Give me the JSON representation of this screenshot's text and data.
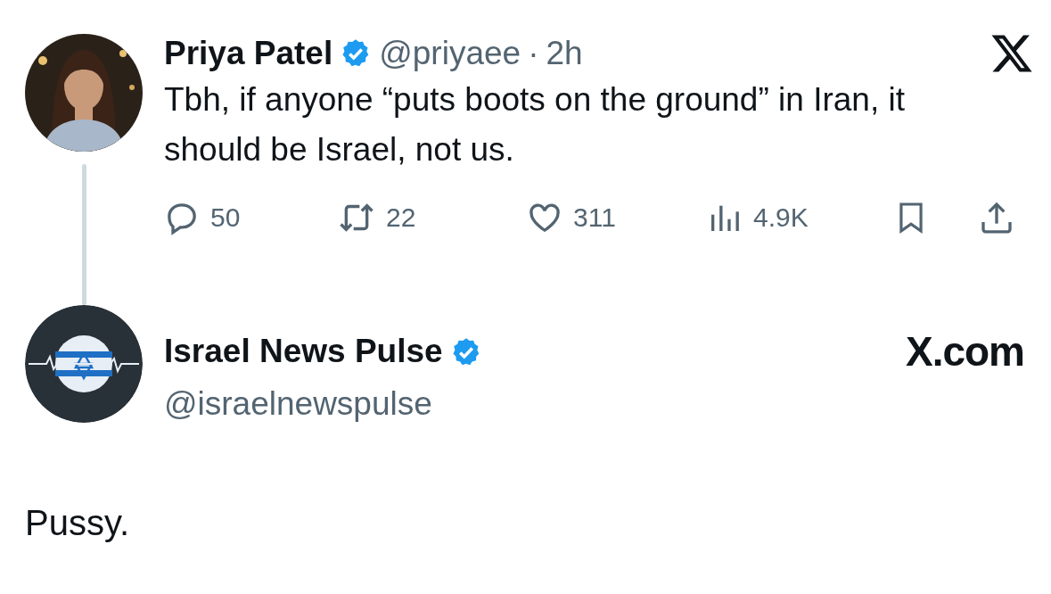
{
  "tweet": {
    "name": "Priya Patel",
    "verified": true,
    "handle": "@priyaee",
    "separator": "·",
    "time": "2h",
    "text": "Tbh, if anyone “puts boots on the ground” in Iran, it should be Israel, not us.",
    "stats": [
      {
        "kind": "reply",
        "count": "50"
      },
      {
        "kind": "retweet",
        "count": "22"
      },
      {
        "kind": "like",
        "count": "311"
      },
      {
        "kind": "views",
        "count": "4.9K"
      },
      {
        "kind": "bookmark"
      },
      {
        "kind": "share"
      }
    ]
  },
  "reply": {
    "name": "Israel News Pulse",
    "verified": true,
    "handle": "@israelnewspulse",
    "site": "X.com",
    "text": "Pussy."
  }
}
